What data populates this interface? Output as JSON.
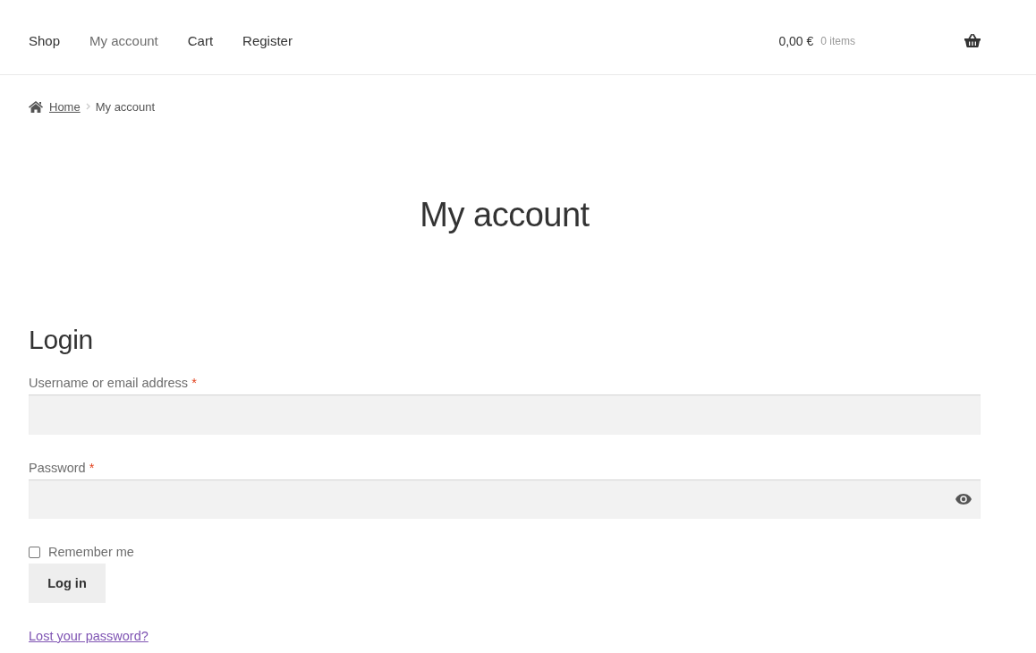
{
  "header": {
    "nav": [
      {
        "label": "Shop",
        "selected": false
      },
      {
        "label": "My account",
        "selected": true
      },
      {
        "label": "Cart",
        "selected": false
      },
      {
        "label": "Register",
        "selected": false
      }
    ],
    "cart": {
      "total": "0,00 €",
      "count": "0 items"
    }
  },
  "breadcrumb": [
    {
      "label": "Home",
      "kind": "link"
    },
    {
      "label": "My account",
      "kind": "current"
    }
  ],
  "page_title": "My account",
  "login": {
    "heading": "Login",
    "fields": [
      {
        "label": "Username or email address",
        "required_mark": "*",
        "kind": "text"
      },
      {
        "label": "Password",
        "required_mark": "*",
        "kind": "password"
      }
    ],
    "remember": {
      "label": "Remember me",
      "checked": false
    },
    "button": "Log in",
    "lost_password": "Lost your password?"
  }
}
